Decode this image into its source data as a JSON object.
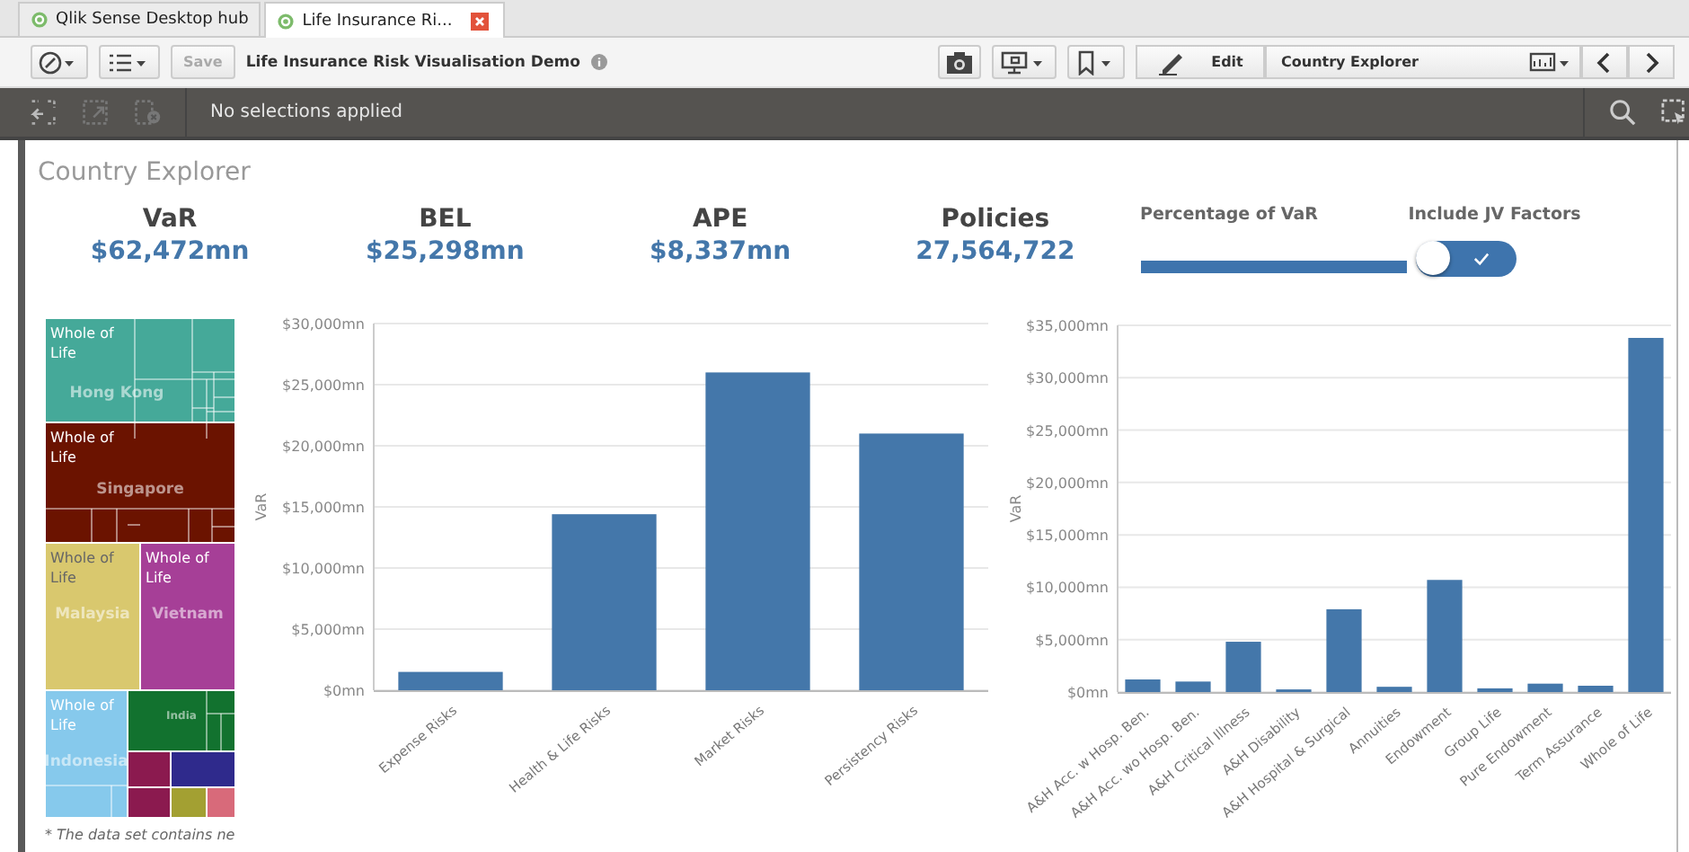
{
  "browser_tabs": [
    {
      "label": "Qlik Sense Desktop hub",
      "selected": false,
      "closable": false
    },
    {
      "label": "Life Insurance Ri...",
      "selected": true,
      "closable": true
    }
  ],
  "toolbar": {
    "save_label": "Save",
    "save_disabled": true,
    "app_title": "Life Insurance Risk Visualisation Demo",
    "edit_label": "Edit",
    "sheet_name": "Country Explorer"
  },
  "selections_bar": {
    "text": "No selections applied"
  },
  "sheet": {
    "title": "Country Explorer",
    "kpis": [
      {
        "label": "VaR",
        "value": "$62,472mn"
      },
      {
        "label": "BEL",
        "value": "$25,298mn"
      },
      {
        "label": "APE",
        "value": "$8,337mn"
      },
      {
        "label": "Policies",
        "value": "27,564,722"
      }
    ],
    "slider": {
      "label": "Percentage of VaR",
      "level": 1
    },
    "toggle": {
      "label": "Include JV Factors",
      "on": true
    },
    "treemap": {
      "regions": [
        {
          "label": "Whole of Life",
          "country": "Hong Kong",
          "color": "#45a999"
        },
        {
          "label": "Whole of Life",
          "country": "Singapore",
          "color": "#6b1300"
        },
        {
          "label": "Whole of Life",
          "country": "Malaysia",
          "color": "#d9c86e"
        },
        {
          "label": "Whole of Life",
          "country": "Vietnam",
          "color": "#a63f97"
        },
        {
          "label": "Whole of Life",
          "country": "Indonesia",
          "color": "#86c9ec"
        },
        {
          "country": "India",
          "color": "#12722f"
        }
      ]
    },
    "charts": [
      {
        "chart_data": {
          "type": "bar",
          "ylabel": "VaR",
          "categories": [
            "Expense Risks",
            "Health & Life Risks",
            "Market Risks",
            "Persistency Risks"
          ],
          "series": [
            {
              "color": "#4477aa",
              "values": [
                1500,
                14400,
                26000,
                21000
              ]
            }
          ],
          "grid": true,
          "ylim": [
            0,
            30000
          ],
          "yticks": [
            {
              "value": 0,
              "label": "$0mn"
            },
            {
              "value": 5000,
              "label": "$5,000mn"
            },
            {
              "value": 10000,
              "label": "$10,000mn"
            },
            {
              "value": 15000,
              "label": "$15,000mn"
            },
            {
              "value": 20000,
              "label": "$20,000mn"
            },
            {
              "value": 25000,
              "label": "$25,000mn"
            },
            {
              "value": 30000,
              "label": "$30,000mn"
            }
          ]
        }
      },
      {
        "chart_data": {
          "type": "bar",
          "ylabel": "VaR",
          "categories": [
            "A&H Acc. w Hosp. Ben.",
            "A&H Acc. wo Hosp. Ben.",
            "A&H Critical Illness",
            "A&H Disability",
            "A&H Hospital & Surgical",
            "Annuities",
            "Endowment",
            "Group Life",
            "Pure Endowment",
            "Term Assurance",
            "Whole of Life"
          ],
          "series": [
            {
              "color": "#4477aa",
              "values": [
                1200,
                1000,
                4800,
                250,
                7900,
                500,
                10700,
                350,
                800,
                600,
                33800
              ]
            }
          ],
          "grid": true,
          "ylim": [
            0,
            35000
          ],
          "yticks": [
            {
              "value": 0,
              "label": "$0mn"
            },
            {
              "value": 5000,
              "label": "$5,000mn"
            },
            {
              "value": 10000,
              "label": "$10,000mn"
            },
            {
              "value": 15000,
              "label": "$15,000mn"
            },
            {
              "value": 20000,
              "label": "$20,000mn"
            },
            {
              "value": 25000,
              "label": "$25,000mn"
            },
            {
              "value": 30000,
              "label": "$30,000mn"
            },
            {
              "value": 35000,
              "label": "$35,000mn"
            }
          ]
        }
      }
    ],
    "footnote": "* The data set contains ne"
  }
}
